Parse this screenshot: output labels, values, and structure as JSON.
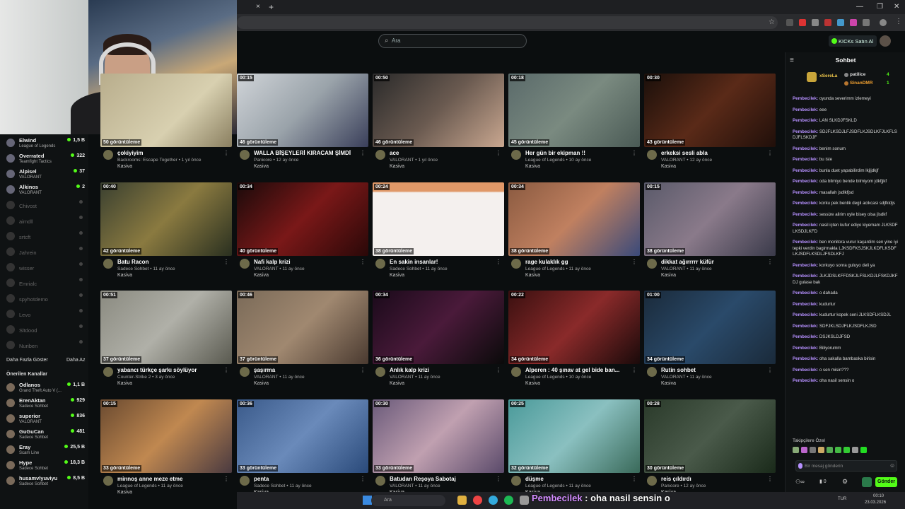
{
  "browser": {
    "close_tab": "×",
    "new_tab": "+",
    "window_controls": [
      "—",
      "❐",
      "✕"
    ]
  },
  "header": {
    "search_placeholder": "Ara",
    "buy_kicks": "KICKs Satın Al"
  },
  "sidebar": {
    "followed": [
      {
        "name": "Elwind",
        "game": "League of Legends",
        "viewers": "1,5 B",
        "online": true
      },
      {
        "name": "Overrated",
        "game": "Teamfight Tactics",
        "viewers": "322",
        "online": true
      },
      {
        "name": "Alpisel",
        "game": "VALORANT",
        "viewers": "37",
        "online": true
      },
      {
        "name": "Alkinos",
        "game": "VALORANT",
        "viewers": "2",
        "online": true
      },
      {
        "name": "Chivost",
        "online": false
      },
      {
        "name": "aimdll",
        "online": false
      },
      {
        "name": "srtcft",
        "online": false
      },
      {
        "name": "Jahrein",
        "online": false
      },
      {
        "name": "wisser",
        "online": false
      },
      {
        "name": "Emrialc",
        "online": false
      },
      {
        "name": "spyhotdemo",
        "online": false
      },
      {
        "name": "Levo",
        "online": false
      },
      {
        "name": "Sltdood",
        "online": false
      },
      {
        "name": "Nuriben",
        "online": false
      }
    ],
    "show_more": "Daha Fazla Göster",
    "show_less": "Daha Az",
    "recommended_title": "Önerilen Kanallar",
    "recommended": [
      {
        "name": "Odlanos",
        "game": "Grand Theft Auto V (...",
        "viewers": "1,1 B"
      },
      {
        "name": "ErenAktan",
        "game": "Sadece Sohbet",
        "viewers": "929"
      },
      {
        "name": "superior",
        "game": "VALORANT",
        "viewers": "836"
      },
      {
        "name": "GuGuCan",
        "game": "Sadece Sohbet",
        "viewers": "481"
      },
      {
        "name": "Eray",
        "game": "Scam Line",
        "viewers": "25,5 B"
      },
      {
        "name": "Hype",
        "game": "Sadece Sohbet",
        "viewers": "18,3 B"
      },
      {
        "name": "husamvlyuviyu",
        "game": "Sadece Sohbet",
        "viewers": "8,5 B"
      }
    ]
  },
  "videos": [
    {
      "dur": "",
      "views": "50 görüntüleme",
      "title": "çokiyiyim",
      "meta": "Backrooms: Escape Together • 1 yıl önce",
      "author": "Kasiva",
      "bg": "linear-gradient(135deg,#b8ad8c,#d8d0b0 60%,#8a7f60)"
    },
    {
      "dur": "00:15",
      "views": "46 görüntüleme",
      "title": "WALLA BİŞEYLERİ KIRACAM ŞİMDİ",
      "meta": "Panicore • 12 ay önce",
      "author": "Kasiva",
      "bg": "linear-gradient(135deg,#d0d4d8,#9aa3aa 50%,#3a3f5a)"
    },
    {
      "dur": "00:50",
      "views": "46 görüntüleme",
      "title": "ace",
      "meta": "VALORANT • 1 yıl önce",
      "author": "Kasiva",
      "bg": "linear-gradient(135deg,#2a2a2a,#6a5a50 50%,#c9a790)"
    },
    {
      "dur": "00:18",
      "views": "45 görüntüleme",
      "title": "Her gün bir ekipman !!",
      "meta": "League of Legends • 10 ay önce",
      "author": "Kasiva",
      "bg": "linear-gradient(135deg,#5a6a6a,#7a8a80 50%,#4a5a55)"
    },
    {
      "dur": "00:30",
      "views": "43 görüntüleme",
      "title": "erkeksi sesli abla",
      "meta": "VALORANT • 12 ay önce",
      "author": "Kasiva",
      "bg": "linear-gradient(135deg,#1a0f0a,#5a2a18 50%,#200f0a)"
    },
    {
      "dur": "00:40",
      "views": "42 görüntüleme",
      "title": "Batu Racon",
      "meta": "Sadece Sohbet • 11 ay önce",
      "author": "Kasiva",
      "bg": "linear-gradient(135deg,#3a4030,#8a7a40 50%,#2a3020)"
    },
    {
      "dur": "00:34",
      "views": "40 görüntüleme",
      "title": "Nafi kalp krizi",
      "meta": "VALORANT • 11 ay önce",
      "author": "Kasiva",
      "bg": "linear-gradient(135deg,#1a0a0a,#7a1818 50%,#2a0808)"
    },
    {
      "dur": "00:24",
      "views": "38 görüntüleme",
      "title": "En sakin insanlar!",
      "meta": "Sadece Sohbet • 11 ay önce",
      "author": "Kasiva",
      "bg": "linear-gradient(180deg,#e09868 0%,#e09868 12%,#f4f0ee 14%,#f4f0ee 100%)"
    },
    {
      "dur": "00:34",
      "views": "38 görüntüleme",
      "title": "rage kulaklık gg",
      "meta": "League of Legends • 11 ay önce",
      "author": "Kasiva",
      "bg": "linear-gradient(135deg,#8a5a40,#c08060 50%,#3a4a7a)"
    },
    {
      "dur": "00:15",
      "views": "38 görüntüleme",
      "title": "dikkat ağırrrrr küfür",
      "meta": "VALORANT • 11 ay önce",
      "author": "Kasiva",
      "bg": "linear-gradient(135deg,#5a5a6a,#8a7a8a 50%,#3a3a4a)"
    },
    {
      "dur": "00:51",
      "views": "37 görüntüleme",
      "title": "yabancı türkçe şarkı söylüyor",
      "meta": "Counter-Strike 2 • 3 ay önce",
      "author": "Kasiva",
      "bg": "linear-gradient(135deg,#8a8a80,#b0b0a8 50%,#5a5a50)"
    },
    {
      "dur": "00:46",
      "views": "37 görüntüleme",
      "title": "şaşırma",
      "meta": "VALORANT • 11 ay önce",
      "author": "Kasiva",
      "bg": "linear-gradient(135deg,#7a6a58,#a08870 50%,#4a3a30)"
    },
    {
      "dur": "00:34",
      "views": "36 görüntüleme",
      "title": "Anlık kalp krizi",
      "meta": "VALORANT • 11 ay önce",
      "author": "Kasiva",
      "bg": "linear-gradient(135deg,#1a0a1a,#4a1a3a 50%,#0a0a0a)"
    },
    {
      "dur": "00:22",
      "views": "34 görüntüleme",
      "title": "Alperen : 40 şınav at gel bide ban...",
      "meta": "League of Legends • 10 ay önce",
      "author": "Kasiva",
      "bg": "linear-gradient(135deg,#3a1010,#8a2a2a 50%,#1a0a0a)"
    },
    {
      "dur": "01:00",
      "views": "34 görüntüleme",
      "title": "Rutin sohbet",
      "meta": "VALORANT • 11 ay önce",
      "author": "Kasiva",
      "bg": "linear-gradient(135deg,#1a2a3a,#2a4a6a 50%,#1a2a3a)"
    },
    {
      "dur": "00:15",
      "views": "33 görüntüleme",
      "title": "minnoş anne meze etme",
      "meta": "League of Legends • 11 ay önce",
      "author": "Kasiva",
      "bg": "linear-gradient(135deg,#6a4a30,#c08850 50%,#4a3a40)"
    },
    {
      "dur": "00:36",
      "views": "33 görüntüleme",
      "title": "penta",
      "meta": "Sadece Sohbet • 11 ay önce",
      "author": "Kasiva",
      "bg": "linear-gradient(135deg,#3a5a8a,#6a8aba 50%,#2a4a7a)"
    },
    {
      "dur": "00:30",
      "views": "33 görüntüleme",
      "title": "Batudan Reşoya Sabotaj",
      "meta": "VALORANT • 11 ay önce",
      "author": "Kasiva",
      "bg": "linear-gradient(135deg,#6a5a7a,#c0a0b0 50%,#5a4a6a)"
    },
    {
      "dur": "00:25",
      "views": "32 görüntüleme",
      "title": "düşme",
      "meta": "League of Legends • 11 ay önce",
      "author": "Kasiva",
      "bg": "linear-gradient(135deg,#4a9a9a,#8ac0c0 50%,#3a6a5a)"
    },
    {
      "dur": "00:28",
      "views": "30 görüntüleme",
      "title": "reis çıldırdı",
      "meta": "Panicore • 12 ay önce",
      "author": "Kasiva",
      "bg": "linear-gradient(135deg,#2a3a2a,#4a5a4a 50%,#1a2a1a)"
    }
  ],
  "chat": {
    "title": "Sohbet",
    "leaders": [
      {
        "name": "xSereLa",
        "count": ""
      },
      {
        "name": "patilice",
        "count": "4"
      },
      {
        "name": "SinanDMR",
        "count": "1"
      }
    ],
    "messages": [
      {
        "user": "Pembecilek",
        "text": "oyunda severimm izlemeyi"
      },
      {
        "user": "Pembecilek",
        "text": "eee"
      },
      {
        "user": "Pembecilek",
        "text": "LAN SLKDJFSKLD"
      },
      {
        "user": "Pembecilek",
        "text": "SDJFLKSDJLFJSDFLKJSDLKFJLKFLSDJFLSKDJF"
      },
      {
        "user": "Pembecilek",
        "text": "benim sonum"
      },
      {
        "user": "Pembecilek",
        "text": "bu iste"
      },
      {
        "user": "Pembecilek",
        "text": "bunla duet yapabilirdim lkjljdkjf"
      },
      {
        "user": "Pembecilek",
        "text": "oda bilmiyo bende bilmiyom jdkfjjkf"
      },
      {
        "user": "Pembecilek",
        "text": "masallah jsdlkfjsd"
      },
      {
        "user": "Pembecilek",
        "text": "korku pek benlik degil acikcasi sdjfkldjs"
      },
      {
        "user": "Pembecilek",
        "text": "sessize alirim oyle bisey olsa jlsdkf"
      },
      {
        "user": "Pembecilek",
        "text": "nasil içten kufur ediyo kiyemam JLKSDFLKSDJLKFD"
      },
      {
        "user": "Pembecilek",
        "text": "ben monitora vurur kaçardim sen yine iyi tepki verdin bagirmakla LJKSDFKSJSKJLKDFLKSDFLKJSDFLKSDLJFSDLKFJ"
      },
      {
        "user": "Pembecilek",
        "text": "korkuyo sonra guluyo deli ya"
      },
      {
        "user": "Pembecilek",
        "text": "JLKJDSLKFFDSKJLFSLKDJLFSKDJKFDJ gulase bak"
      },
      {
        "user": "Pembecilek",
        "text": "o dahada"
      },
      {
        "user": "Pembecilek",
        "text": "kudurtur"
      },
      {
        "user": "Pembecilek",
        "text": "kudurtur kopek seni JLKSDFLKSDJL"
      },
      {
        "user": "Pembecilek",
        "text": "SDFJKLSDJFLKJSDFLKJSD"
      },
      {
        "user": "Pembecilek",
        "text": "DSJKSLDJFSD"
      },
      {
        "user": "Pembecilek",
        "text": "Biliyorumm"
      },
      {
        "user": "Pembecilek",
        "text": "oha sakalla bambaska birisin"
      },
      {
        "user": "Pembecilek",
        "text": "o sen misin???"
      },
      {
        "user": "Pembecilek",
        "text": "oha nasil sensin o"
      }
    ],
    "followers_only": "Takipçilere Özel",
    "input_placeholder": "Bir mesaj gönderin",
    "kick_count": "0",
    "send": "Gönder"
  },
  "caption": {
    "user": "Pembecilek",
    "text": " : oha nasil sensin o"
  },
  "taskbar": {
    "search": "Ara",
    "lang": "TUR",
    "time": "00:10",
    "date": "23.03.2026"
  }
}
